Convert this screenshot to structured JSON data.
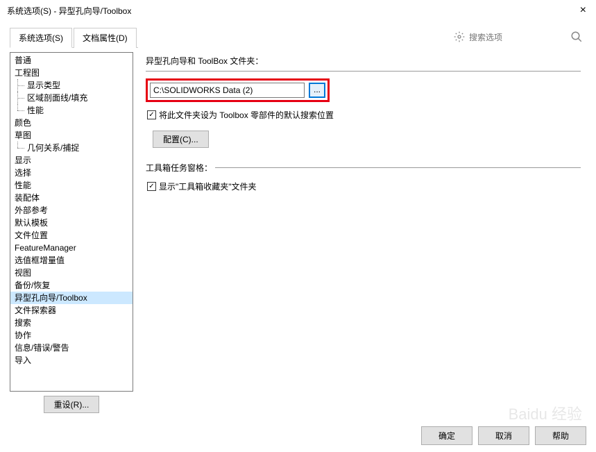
{
  "window": {
    "title": "系统选项(S) - 异型孔向导/Toolbox",
    "close": "×"
  },
  "tabs": {
    "system_options": "系统选项(S)",
    "system_options_underline": "S",
    "doc_props": "文档属性(D)",
    "doc_props_underline": "D"
  },
  "search": {
    "placeholder": "搜索选项"
  },
  "tree": [
    {
      "label": "普通",
      "type": "root"
    },
    {
      "label": "工程图",
      "type": "root"
    },
    {
      "label": "显示类型",
      "type": "child",
      "hasNext": true
    },
    {
      "label": "区域剖面线/填充",
      "type": "child",
      "hasNext": true
    },
    {
      "label": "性能",
      "type": "child",
      "hasNext": false
    },
    {
      "label": "颜色",
      "type": "root"
    },
    {
      "label": "草图",
      "type": "root"
    },
    {
      "label": "几何关系/捕捉",
      "type": "child",
      "hasNext": false
    },
    {
      "label": "显示",
      "type": "root"
    },
    {
      "label": "选择",
      "type": "root"
    },
    {
      "label": "性能",
      "type": "root"
    },
    {
      "label": "装配体",
      "type": "root"
    },
    {
      "label": "外部参考",
      "type": "root"
    },
    {
      "label": "默认模板",
      "type": "root"
    },
    {
      "label": "文件位置",
      "type": "root"
    },
    {
      "label": "FeatureManager",
      "type": "root"
    },
    {
      "label": "选值框增量值",
      "type": "root"
    },
    {
      "label": "视图",
      "type": "root"
    },
    {
      "label": "备份/恢复",
      "type": "root"
    },
    {
      "label": "异型孔向导/Toolbox",
      "type": "root",
      "selected": true
    },
    {
      "label": "文件探索器",
      "type": "root"
    },
    {
      "label": "搜索",
      "type": "root"
    },
    {
      "label": "协作",
      "type": "root"
    },
    {
      "label": "信息/错误/警告",
      "type": "root"
    },
    {
      "label": "导入",
      "type": "root"
    }
  ],
  "reset_btn": "重设(R)...",
  "right": {
    "group1_label": "异型孔向导和 ToolBox 文件夹：",
    "folder_value": "C:\\SOLIDWORKS Data (2)",
    "browse": "...",
    "checkbox1_label": "将此文件夹设为 Toolbox 零部件的默认搜索位置",
    "config_btn": "配置(C)...",
    "group2_label": "工具箱任务窗格：",
    "checkbox2_label": "显示\"工具箱收藏夹\"文件夹"
  },
  "footer": {
    "ok": "确定",
    "cancel": "取消",
    "help": "帮助"
  },
  "watermark": "Baidu 经验"
}
